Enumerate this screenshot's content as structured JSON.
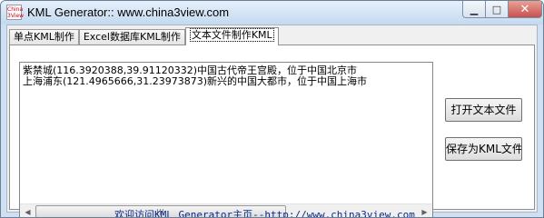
{
  "window": {
    "title": "KML Generator:: www.china3view.com",
    "icon_text_line1": "China",
    "icon_text_line2": "3View",
    "minimize_glyph": "▁",
    "maximize_glyph": "□",
    "close_glyph": "✕"
  },
  "tabs": [
    {
      "label": "单点KML制作",
      "active": false
    },
    {
      "label": "Excel数据库KML制作",
      "active": false
    },
    {
      "label": "文本文件制作KML",
      "active": true
    }
  ],
  "text_content": {
    "lines": [
      "紫禁城(116.3920388,39.91120332)中国古代帝王宫殿，位于中国北京市",
      "上海浦东(121.4965666,31.23973873)新兴的中国大都市，位于中国上海市"
    ]
  },
  "scrollbar": {
    "left_glyph": "◀",
    "right_glyph": "▶"
  },
  "buttons": {
    "open_label": "打开文本文件",
    "save_label": "保存为KML文件"
  },
  "footer": {
    "link_text": "欢迎访问KML Generator主页--http://www.china3view.com"
  },
  "colors": {
    "link": "#0a2a8a",
    "close_button": "#c75050",
    "window_frame": "#cfe0f3"
  }
}
